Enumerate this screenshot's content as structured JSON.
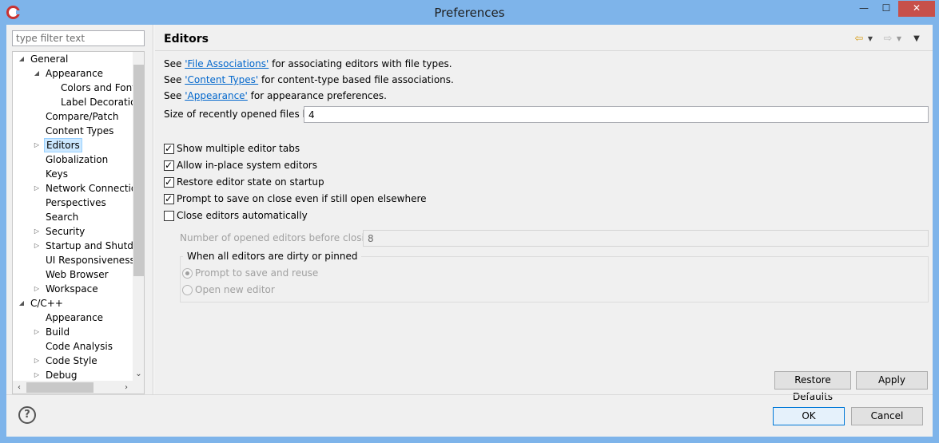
{
  "window": {
    "title": "Preferences",
    "minimize_glyph": "—",
    "maximize_glyph": "☐",
    "close_glyph": "✕"
  },
  "filter": {
    "placeholder": "type filter text"
  },
  "tree": {
    "expanded_glyph": "◢",
    "collapsed_glyph": "▷",
    "items": [
      {
        "label": "General",
        "depth": 0,
        "toggle": "expanded"
      },
      {
        "label": "Appearance",
        "depth": 1,
        "toggle": "expanded"
      },
      {
        "label": "Colors and Fonts",
        "depth": 2,
        "toggle": "none"
      },
      {
        "label": "Label Decorations",
        "depth": 2,
        "toggle": "none"
      },
      {
        "label": "Compare/Patch",
        "depth": 1,
        "toggle": "none"
      },
      {
        "label": "Content Types",
        "depth": 1,
        "toggle": "none"
      },
      {
        "label": "Editors",
        "depth": 1,
        "toggle": "collapsed",
        "selected": true
      },
      {
        "label": "Globalization",
        "depth": 1,
        "toggle": "none"
      },
      {
        "label": "Keys",
        "depth": 1,
        "toggle": "none"
      },
      {
        "label": "Network Connections",
        "depth": 1,
        "toggle": "collapsed"
      },
      {
        "label": "Perspectives",
        "depth": 1,
        "toggle": "none"
      },
      {
        "label": "Search",
        "depth": 1,
        "toggle": "none"
      },
      {
        "label": "Security",
        "depth": 1,
        "toggle": "collapsed"
      },
      {
        "label": "Startup and Shutdown",
        "depth": 1,
        "toggle": "collapsed"
      },
      {
        "label": "UI Responsiveness Monitoring",
        "depth": 1,
        "toggle": "none"
      },
      {
        "label": "Web Browser",
        "depth": 1,
        "toggle": "none"
      },
      {
        "label": "Workspace",
        "depth": 1,
        "toggle": "collapsed"
      },
      {
        "label": "C/C++",
        "depth": 0,
        "toggle": "expanded"
      },
      {
        "label": "Appearance",
        "depth": 1,
        "toggle": "none"
      },
      {
        "label": "Build",
        "depth": 1,
        "toggle": "collapsed"
      },
      {
        "label": "Code Analysis",
        "depth": 1,
        "toggle": "none"
      },
      {
        "label": "Code Style",
        "depth": 1,
        "toggle": "collapsed"
      },
      {
        "label": "Debug",
        "depth": 1,
        "toggle": "collapsed"
      }
    ],
    "scroll_down_glyph": "⌄",
    "scroll_left_glyph": "‹",
    "scroll_right_glyph": "›"
  },
  "page": {
    "title": "Editors",
    "nav": {
      "back_glyph": "⇦",
      "back_menu_glyph": "▼",
      "forward_glyph": "⇨",
      "forward_menu_glyph": "▼",
      "view_menu_glyph": "▼"
    },
    "see_lines": [
      {
        "prefix": "See ",
        "link": "'File Associations'",
        "suffix": " for associating editors with file types."
      },
      {
        "prefix": "See ",
        "link": "'Content Types'",
        "suffix": " for content-type based file associations."
      },
      {
        "prefix": "See ",
        "link": "'Appearance'",
        "suffix": " for appearance preferences."
      }
    ],
    "recent_files": {
      "label": "Size of recently opened files list:",
      "value": "4"
    },
    "checkboxes": [
      {
        "label": "Show multiple editor tabs",
        "checked": true
      },
      {
        "label": "Allow in-place system editors",
        "checked": true
      },
      {
        "label": "Restore editor state on startup",
        "checked": true
      },
      {
        "label": "Prompt to save on close even if still open elsewhere",
        "checked": true
      },
      {
        "label": "Close editors automatically",
        "checked": false
      }
    ],
    "opened_editors": {
      "label": "Number of opened editors before closing:",
      "value": "8"
    },
    "dirty_group": {
      "title": "When all editors are dirty or pinned",
      "options": [
        {
          "label": "Prompt to save and reuse",
          "checked": true
        },
        {
          "label": "Open new editor",
          "checked": false
        }
      ]
    },
    "restore_defaults_label": "Restore Defaults",
    "apply_label": "Apply"
  },
  "footer": {
    "help_glyph": "?",
    "ok_label": "OK",
    "cancel_label": "Cancel"
  }
}
